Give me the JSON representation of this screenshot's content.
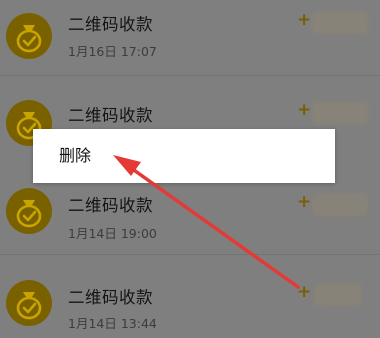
{
  "transactions": [
    {
      "title": "二维码收款",
      "time": "1月16日 17:07",
      "amount_prefix": "+"
    },
    {
      "title": "二维码收款",
      "time": "",
      "amount_prefix": "+"
    },
    {
      "title": "二维码收款",
      "time": "1月14日 19:00",
      "amount_prefix": "+"
    },
    {
      "title": "二维码收款",
      "time": "1月14日 13:44",
      "amount_prefix": "+"
    }
  ],
  "context_menu": {
    "delete_label": "删除"
  },
  "colors": {
    "icon_bg": "#7a6100",
    "amount": "#7a5f00",
    "arrow": "#e53935"
  },
  "icons": {
    "transaction": "money-bag-check-icon"
  }
}
